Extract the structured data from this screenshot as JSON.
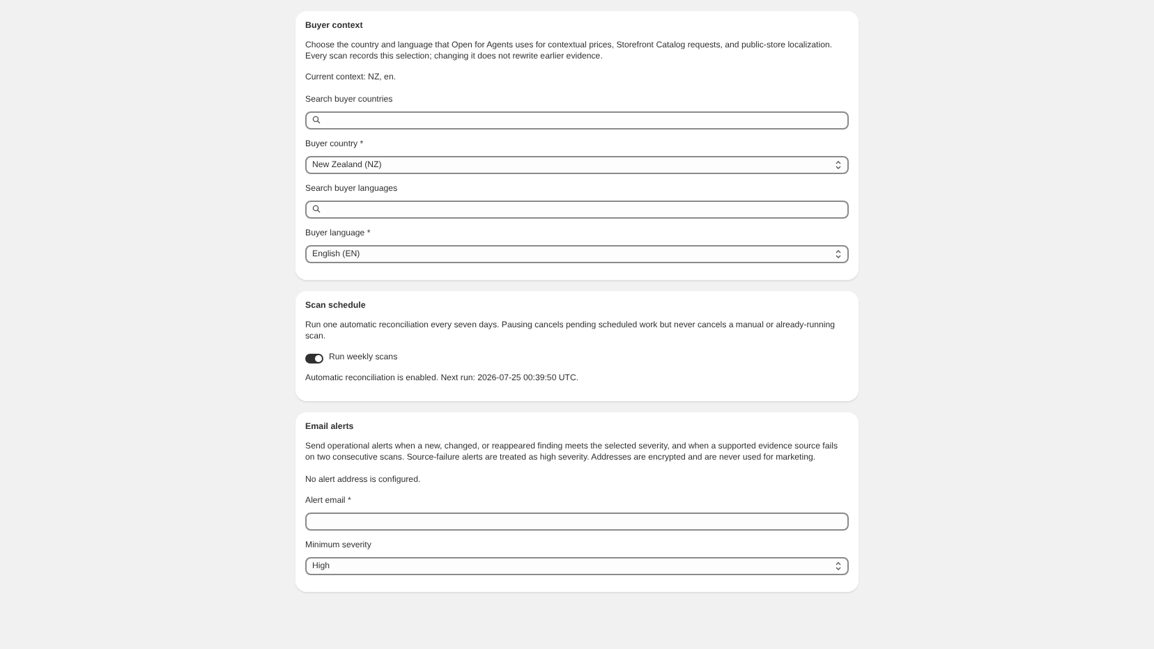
{
  "sections": [
    {
      "title": "Buyer context",
      "items": [
        {
          "kind": "text",
          "text": "Choose the country and language that Open for Agents uses for contextual prices, Storefront Catalog requests, and public-store localization. Every scan records this selection; changing it does not rewrite earlier evidence."
        },
        {
          "kind": "text",
          "text": "Current context: NZ, en."
        },
        {
          "kind": "search",
          "label": "Search buyer countries"
        },
        {
          "kind": "select",
          "label": "Buyer country *",
          "value": "New Zealand (NZ)"
        },
        {
          "kind": "search",
          "label": "Search buyer languages"
        },
        {
          "kind": "select",
          "label": "Buyer language *",
          "value": "English (EN)"
        }
      ]
    },
    {
      "title": "Scan schedule",
      "items": [
        {
          "kind": "text",
          "text": "Run one automatic reconciliation every seven days. Pausing cancels pending scheduled work but never cancels a manual or already-running scan."
        },
        {
          "kind": "toggle",
          "label": "Run weekly scans",
          "on": true
        },
        {
          "kind": "text",
          "text": "Automatic reconciliation is enabled. Next run: 2026-07-25 00:39:50 UTC."
        }
      ]
    },
    {
      "title": "Email alerts",
      "items": [
        {
          "kind": "text",
          "text": "Send operational alerts when a new, changed, or reappeared finding meets the selected severity, and when a supported evidence source fails on two consecutive scans. Source-failure alerts are treated as high severity. Addresses are encrypted and are never used for marketing."
        },
        {
          "kind": "text",
          "text": "No alert address is configured."
        },
        {
          "kind": "input",
          "label": "Alert email *"
        },
        {
          "kind": "select",
          "label": "Minimum severity",
          "value": "High"
        }
      ]
    }
  ]
}
